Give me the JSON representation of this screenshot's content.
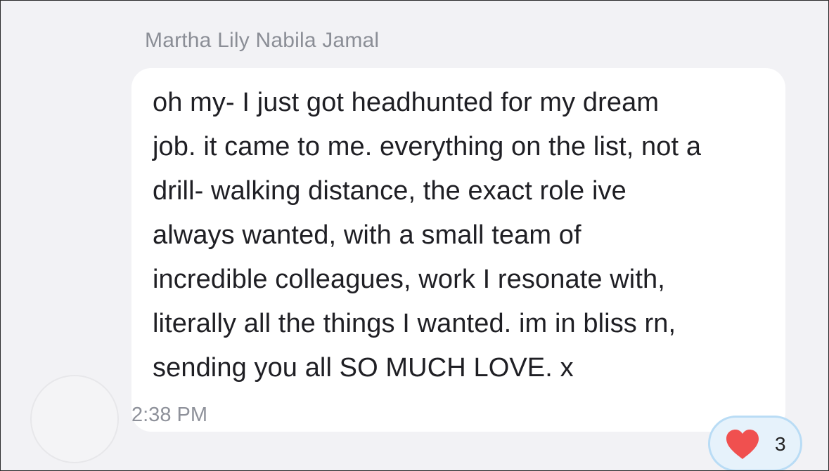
{
  "message": {
    "sender": "Martha Lily Nabila Jamal",
    "text": "oh my- I just got headhunted for my dream\njob. it came to me. everything on the list, not a\ndrill- walking distance, the exact role ive\nalways wanted, with a small team of\nincredible colleagues, work I resonate with,\nliterally all the things I wanted. im in bliss rn,\nsending you all SO MUCH LOVE. x",
    "time": "2:38 PM"
  },
  "reaction": {
    "icon": "heart-icon",
    "count": "3",
    "heart_color": "#f0504f",
    "bubble_border": "#b9dcf5",
    "bubble_fill": "#e6f2fb"
  }
}
